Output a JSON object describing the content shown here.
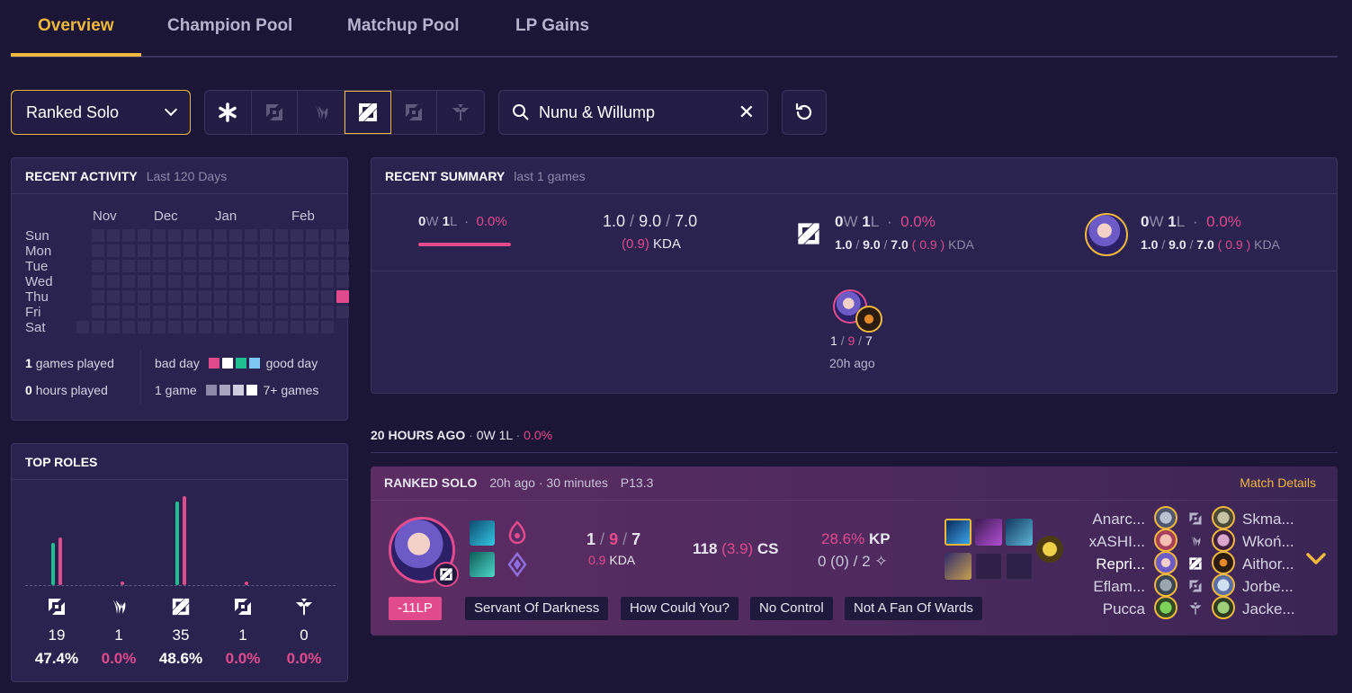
{
  "tabs": [
    "Overview",
    "Champion Pool",
    "Matchup Pool",
    "LP Gains"
  ],
  "filters": {
    "queue": "Ranked Solo",
    "search_value": "Nunu & Willump",
    "roles": [
      "all-roles",
      "top",
      "jungle",
      "mid",
      "bottom",
      "support"
    ],
    "selected_role": "jungle"
  },
  "activity": {
    "title": "RECENT ACTIVITY",
    "subtitle": "Last 120 Days",
    "months": [
      "Nov",
      "Dec",
      "Jan",
      "Feb"
    ],
    "days": [
      "Sun",
      "Mon",
      "Tue",
      "Wed",
      "Thu",
      "Fri",
      "Sat"
    ],
    "games_played_n": "1",
    "games_played_label": "games played",
    "hours_played_n": "0",
    "hours_played_label": "hours played",
    "bad_day": "bad day",
    "good_day": "good day",
    "one_game": "1 game",
    "seven_plus": "7+ games"
  },
  "top_roles": {
    "title": "TOP ROLES",
    "roles": [
      {
        "name": "top",
        "games": "19",
        "winrate": "47.4%",
        "bar_green": 0.47,
        "bar_pink": 0.53
      },
      {
        "name": "jungle",
        "games": "1",
        "winrate": "0.0%",
        "bar_green": 0.0,
        "bar_pink": 0.03
      },
      {
        "name": "mid",
        "games": "35",
        "winrate": "48.6%",
        "bar_green": 0.93,
        "bar_pink": 0.99
      },
      {
        "name": "bottom",
        "games": "1",
        "winrate": "0.0%",
        "bar_green": 0.0,
        "bar_pink": 0.03
      },
      {
        "name": "support",
        "games": "0",
        "winrate": "0.0%",
        "bar_green": 0.0,
        "bar_pink": 0.0
      }
    ]
  },
  "summary": {
    "title": "RECENT SUMMARY",
    "subtitle": "last 1 games",
    "overall": {
      "w": "0",
      "l": "1",
      "wr": "0.0%"
    },
    "kda": {
      "k": "1.0",
      "d": "9.0",
      "a": "7.0",
      "ratio": "(0.9)",
      "label": "KDA"
    },
    "role": {
      "w": "0",
      "l": "1",
      "wr": "0.0%",
      "k": "1.0",
      "d": "9.0",
      "a": "7.0",
      "ratio": "( 0.9 )",
      "label": "KDA"
    },
    "champ": {
      "w": "0",
      "l": "1",
      "wr": "0.0%",
      "k": "1.0",
      "d": "9.0",
      "a": "7.0",
      "ratio": "( 0.9 )",
      "label": "KDA"
    },
    "game": {
      "k": "1",
      "d": "9",
      "a": "7",
      "ago": "20h ago"
    }
  },
  "day_header": {
    "ago": "20 HOURS AGO",
    "record": "0W 1L",
    "wr": "0.0%"
  },
  "match": {
    "queue": "RANKED SOLO",
    "ago": "20h ago",
    "duration": "30 minutes",
    "patch": "P13.3",
    "details": "Match Details",
    "k": "1",
    "d": "9",
    "a": "7",
    "kda_ratio": "0.9",
    "kda_label": "KDA",
    "cs": "118",
    "cs_per_min": "(3.9)",
    "cs_label": "CS",
    "kp": "28.6%",
    "kp_label": "KP",
    "wards": "0 (0) / 2",
    "lp": "-11LP",
    "tags": [
      "Servant Of Darkness",
      "How Could You?",
      "No Control",
      "Not A Fan Of Wards"
    ],
    "team_left": [
      "Anarc...",
      "xASHI...",
      "Repri...",
      "Eflam...",
      "Pucca"
    ],
    "team_right": [
      "Skma...",
      "Wkoń...",
      "Aithor...",
      "Jorbe...",
      "Jacke..."
    ]
  },
  "colors": {
    "accent": "#f0b73d",
    "loss": "#e14b8d",
    "win": "#1fbf91",
    "bg": "#1b1536",
    "panel": "#2a2350"
  }
}
